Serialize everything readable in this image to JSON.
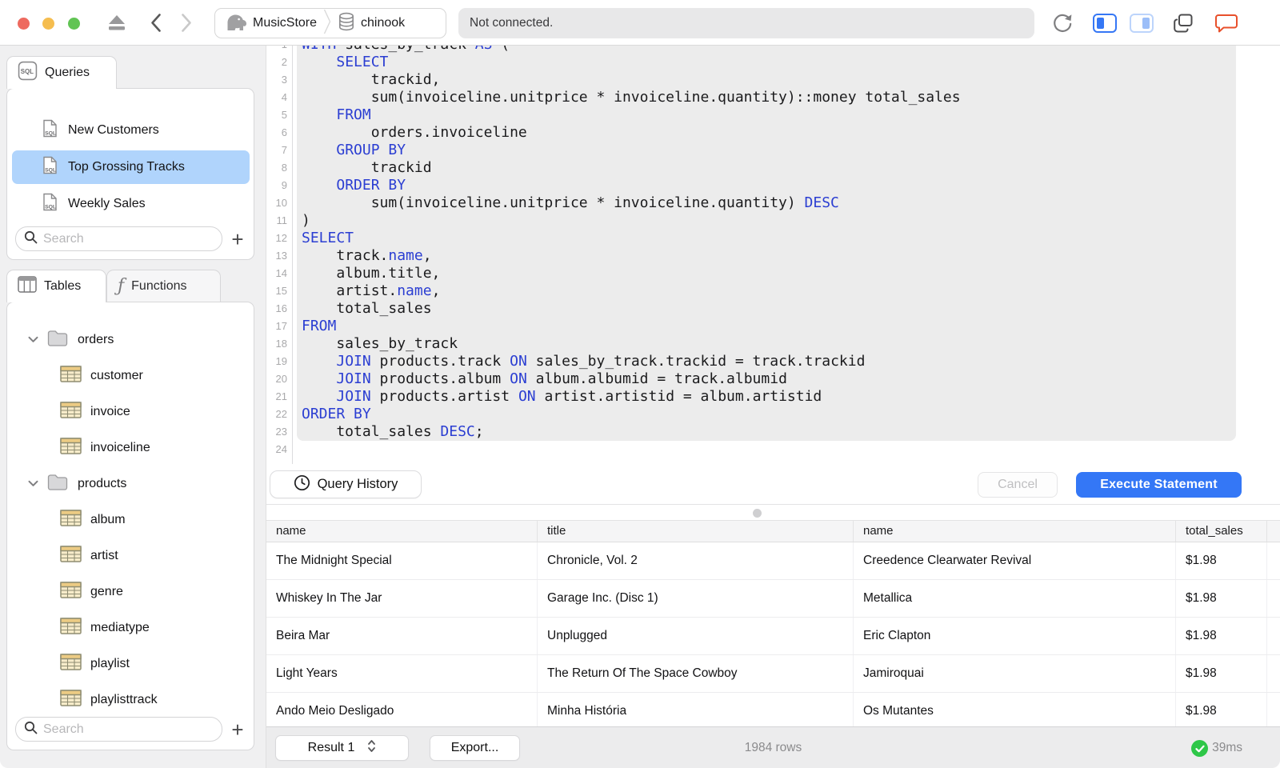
{
  "colors": {
    "accent": "#3477f6",
    "selected_row": "#b0d4fc",
    "keyword_blue": "#2b3ed2",
    "success_green": "#2ec748",
    "chat_orange": "#e8502b"
  },
  "toolbar": {
    "window_controls": [
      "close",
      "minimize",
      "zoom"
    ],
    "icons": [
      "eject-icon",
      "back-icon",
      "forward-icon",
      "refresh-icon",
      "toggle-left-sidebar-icon",
      "toggle-right-sidebar-icon",
      "windows-icon",
      "chat-bubble-icon"
    ],
    "breadcrumb": {
      "server": "MusicStore",
      "database": "chinook"
    },
    "status": "Not connected."
  },
  "sidebar": {
    "queries": {
      "tab_label": "Queries",
      "items": [
        {
          "label": "New Customers",
          "selected": false
        },
        {
          "label": "Top Grossing Tracks",
          "selected": true
        },
        {
          "label": "Weekly Sales",
          "selected": false
        }
      ],
      "search_placeholder": "Search"
    },
    "schema": {
      "tables_tab": "Tables",
      "functions_tab": "Functions",
      "tree": [
        {
          "kind": "folder",
          "label": "orders",
          "expanded": true
        },
        {
          "kind": "table",
          "label": "customer"
        },
        {
          "kind": "table",
          "label": "invoice"
        },
        {
          "kind": "table",
          "label": "invoiceline"
        },
        {
          "kind": "folder",
          "label": "products",
          "expanded": true
        },
        {
          "kind": "table",
          "label": "album"
        },
        {
          "kind": "table",
          "label": "artist"
        },
        {
          "kind": "table",
          "label": "genre"
        },
        {
          "kind": "table",
          "label": "mediatype"
        },
        {
          "kind": "table",
          "label": "playlist"
        },
        {
          "kind": "table",
          "label": "playlisttrack"
        }
      ],
      "search_placeholder": "Search"
    }
  },
  "editor": {
    "lines": [
      [
        [
          "k",
          "WITH"
        ],
        [
          "t",
          " sales_by_track "
        ],
        [
          "k",
          "AS"
        ],
        [
          "t",
          " ("
        ]
      ],
      [
        [
          "t",
          "    "
        ],
        [
          "k",
          "SELECT"
        ]
      ],
      [
        [
          "t",
          "        trackid,"
        ]
      ],
      [
        [
          "t",
          "        sum(invoiceline.unitprice * invoiceline.quantity)::money total_sales"
        ]
      ],
      [
        [
          "t",
          "    "
        ],
        [
          "k",
          "FROM"
        ]
      ],
      [
        [
          "t",
          "        orders.invoiceline"
        ]
      ],
      [
        [
          "t",
          "    "
        ],
        [
          "k",
          "GROUP BY"
        ]
      ],
      [
        [
          "t",
          "        trackid"
        ]
      ],
      [
        [
          "t",
          "    "
        ],
        [
          "k",
          "ORDER BY"
        ]
      ],
      [
        [
          "t",
          "        sum(invoiceline.unitprice * invoiceline.quantity) "
        ],
        [
          "k",
          "DESC"
        ]
      ],
      [
        [
          "t",
          ")"
        ]
      ],
      [
        [
          "k",
          "SELECT"
        ]
      ],
      [
        [
          "t",
          "    track."
        ],
        [
          "k",
          "name"
        ],
        [
          "t",
          ","
        ]
      ],
      [
        [
          "t",
          "    album.title,"
        ]
      ],
      [
        [
          "t",
          "    artist."
        ],
        [
          "k",
          "name"
        ],
        [
          "t",
          ","
        ]
      ],
      [
        [
          "t",
          "    total_sales"
        ]
      ],
      [
        [
          "k",
          "FROM"
        ]
      ],
      [
        [
          "t",
          "    sales_by_track"
        ]
      ],
      [
        [
          "t",
          "    "
        ],
        [
          "k",
          "JOIN"
        ],
        [
          "t",
          " products.track "
        ],
        [
          "k",
          "ON"
        ],
        [
          "t",
          " sales_by_track.trackid = track.trackid"
        ]
      ],
      [
        [
          "t",
          "    "
        ],
        [
          "k",
          "JOIN"
        ],
        [
          "t",
          " products.album "
        ],
        [
          "k",
          "ON"
        ],
        [
          "t",
          " album.albumid = track.albumid"
        ]
      ],
      [
        [
          "t",
          "    "
        ],
        [
          "k",
          "JOIN"
        ],
        [
          "t",
          " products.artist "
        ],
        [
          "k",
          "ON"
        ],
        [
          "t",
          " artist.artistid = album.artistid"
        ]
      ],
      [
        [
          "k",
          "ORDER BY"
        ]
      ],
      [
        [
          "t",
          "    total_sales "
        ],
        [
          "k",
          "DESC"
        ],
        [
          "t",
          ";"
        ]
      ],
      []
    ]
  },
  "actions": {
    "query_history": "Query History",
    "cancel": "Cancel",
    "execute": "Execute Statement"
  },
  "results": {
    "columns": [
      "name",
      "title",
      "name",
      "total_sales"
    ],
    "rows": [
      [
        "The Midnight Special",
        "Chronicle, Vol. 2",
        "Creedence Clearwater Revival",
        "$1.98"
      ],
      [
        "Whiskey In The Jar",
        "Garage Inc. (Disc 1)",
        "Metallica",
        "$1.98"
      ],
      [
        "Beira Mar",
        "Unplugged",
        "Eric Clapton",
        "$1.98"
      ],
      [
        "Light Years",
        "The Return Of The Space Cowboy",
        "Jamiroquai",
        "$1.98"
      ],
      [
        "Ando Meio Desligado",
        "Minha História",
        "Os Mutantes",
        "$1.98"
      ]
    ]
  },
  "status_bar": {
    "result_selector": "Result 1",
    "export_label": "Export...",
    "row_count": "1984 rows",
    "duration": "39ms"
  }
}
